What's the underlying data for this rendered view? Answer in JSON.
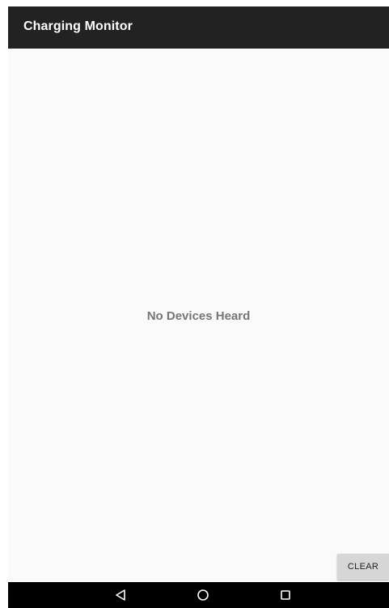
{
  "app_bar": {
    "title": "Charging Monitor"
  },
  "main": {
    "empty_message": "No Devices Heard",
    "clear_label": "CLEAR"
  },
  "nav_bar": {
    "icons": [
      "back-triangle-icon",
      "home-circle-icon",
      "recents-square-icon"
    ]
  },
  "colors": {
    "app_bar_bg": "#222222",
    "content_bg": "#fafafa",
    "message_text": "#757575",
    "button_bg": "#d6d6d6",
    "nav_bar_bg": "#000000"
  }
}
